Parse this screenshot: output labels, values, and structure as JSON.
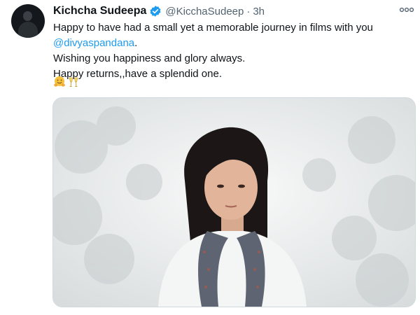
{
  "tweet": {
    "author_name": "Kichcha Sudeepa",
    "handle": "@KicchaSudeep",
    "separator": "·",
    "timestamp": "3h",
    "text_line1": "Happy to have had a small yet a memorable journey in films with you",
    "mention": "@divyaspandana",
    "mention_suffix": ".",
    "text_line3": "Wishing you happiness and glory always.",
    "text_line4": "Happy returns,,have a splendid one.",
    "emojis": [
      "hugging-face-emoji",
      "clinking-glasses-emoji"
    ]
  },
  "icons": {
    "verified": "verified-badge-icon",
    "more": "more-options-icon"
  },
  "colors": {
    "mention": "#1d9bf0",
    "verified": "#1d9bf0",
    "secondary_text": "#536471",
    "media_border": "#cfd9de"
  }
}
